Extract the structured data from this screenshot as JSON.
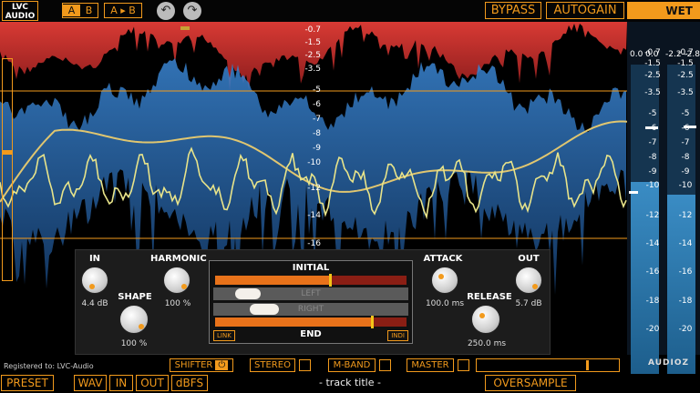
{
  "header": {
    "logo_line1": "LVC",
    "logo_line2": "AUDIO",
    "ab_a": "A",
    "ab_b": "B",
    "ab_copy": "A ▸ B",
    "undo_icon": "↶",
    "redo_icon": "↷",
    "bypass": "BYPASS",
    "autogain": "AUTOGAIN",
    "wet": "WET"
  },
  "db_scale": [
    "-0.7",
    "-1.5",
    "-2.5",
    "-3.5",
    "-5",
    "-6",
    "-7",
    "-8",
    "-9",
    "-10",
    "-12",
    "-14",
    "-16"
  ],
  "meters": {
    "in_header": "0.0 0.0",
    "out_header": "-2.2 -2.8",
    "scale": [
      "-0.7",
      "-1.5",
      "-2.5",
      "-3.5",
      "-5",
      "-6",
      "-7",
      "-8",
      "-9",
      "-10",
      "-12",
      "-14",
      "-16",
      "-18",
      "-20"
    ],
    "level_fraction": 0.62
  },
  "controls": {
    "in": {
      "label": "IN",
      "value": "4.4 dB"
    },
    "shape": {
      "label": "SHAPE",
      "value": "100 %"
    },
    "harmonic": {
      "label": "HARMONIC",
      "value": "100 %"
    },
    "attack": {
      "label": "ATTACK",
      "value": "100.0 ms"
    },
    "release": {
      "label": "RELEASE",
      "value": "250.0 ms"
    },
    "out": {
      "label": "OUT",
      "value": "5.7 dB"
    }
  },
  "envelope": {
    "initial": "INITIAL",
    "end": "END",
    "left": "LEFT",
    "right": "RIGHT",
    "link": "LINK",
    "indi": "INDI",
    "initial_level": 0.6,
    "end_level": 0.82
  },
  "footer": {
    "registered": "Registered to: LVC-Audio",
    "shifter": "SHIFTER",
    "power_icon": "⏻",
    "stereo": "STEREO",
    "mband": "M-BAND",
    "master": "MASTER",
    "preset": "PRESET",
    "wav": "WAV",
    "in": "IN",
    "out": "OUT",
    "dbfs": "dBFS",
    "track_title": "- track title -",
    "oversample": "OVERSAMPLE",
    "watermark": "AUDIOZ"
  },
  "colors": {
    "accent": "#f29a1c",
    "peak_red": "#d83a34",
    "wave_blue": "#2a73c4",
    "curve_yellow": "#e8e48a"
  }
}
